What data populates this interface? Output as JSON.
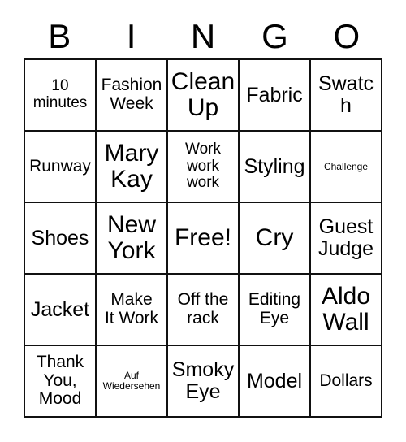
{
  "header": {
    "letters": [
      "B",
      "I",
      "N",
      "G",
      "O"
    ]
  },
  "grid": {
    "columns": 5,
    "rows": 5,
    "border_color": "#111111",
    "background_color": "#ffffff",
    "text_color": "#000000",
    "cells": [
      {
        "text": "10\nminutes",
        "size": "fs-sm"
      },
      {
        "text": "Fashion\nWeek",
        "size": "fs-md"
      },
      {
        "text": "Clean\nUp",
        "size": "fs-xl"
      },
      {
        "text": "Fabric",
        "size": "fs-lg"
      },
      {
        "text": "Swatch",
        "size": "fs-lg"
      },
      {
        "text": "Runway",
        "size": "fs-md"
      },
      {
        "text": "Mary\nKay",
        "size": "fs-xl"
      },
      {
        "text": "Work\nwork\nwork",
        "size": "fs-sm"
      },
      {
        "text": "Styling",
        "size": "fs-lg"
      },
      {
        "text": "Challenge",
        "size": "fs-xs"
      },
      {
        "text": "Shoes",
        "size": "fs-lg"
      },
      {
        "text": "New\nYork",
        "size": "fs-xl"
      },
      {
        "text": "Free!",
        "size": "fs-xl"
      },
      {
        "text": "Cry",
        "size": "fs-xl"
      },
      {
        "text": "Guest\nJudge",
        "size": "fs-lg"
      },
      {
        "text": "Jacket",
        "size": "fs-lg"
      },
      {
        "text": "Make\nIt Work",
        "size": "fs-md"
      },
      {
        "text": "Off the\nrack",
        "size": "fs-md"
      },
      {
        "text": "Editing\nEye",
        "size": "fs-md"
      },
      {
        "text": "Aldo\nWall",
        "size": "fs-xl"
      },
      {
        "text": "Thank\nYou,\nMood",
        "size": "fs-md"
      },
      {
        "text": "Auf\nWiedersehen",
        "size": "fs-xs"
      },
      {
        "text": "Smoky\nEye",
        "size": "fs-lg"
      },
      {
        "text": "Model",
        "size": "fs-lg"
      },
      {
        "text": "Dollars",
        "size": "fs-md"
      }
    ]
  }
}
